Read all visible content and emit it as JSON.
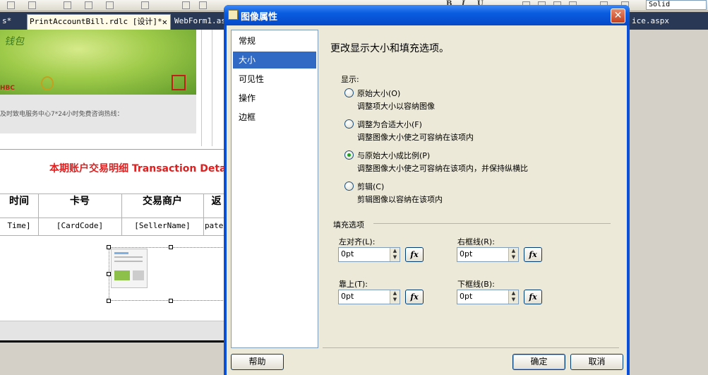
{
  "ide": {
    "toolbar_combo": "Solid",
    "toolbar_format": [
      "B",
      "I",
      "U"
    ],
    "tabs": [
      {
        "label": "s*",
        "active": false
      },
      {
        "label": "PrintAccountBill.rdlc [设计]*",
        "active": true,
        "close": "✕"
      },
      {
        "label": "WebForm1.asp",
        "active": false
      },
      {
        "label": "ice.aspx",
        "active": false
      }
    ]
  },
  "report": {
    "banner_text": "钱包",
    "logo_left": "HBC",
    "hotline": "及时致电服务中心7*24小时免费咨询热线：",
    "section_title": "本期账户交易明细 Transaction Details",
    "headers": [
      "时间",
      "卡号",
      "交易商户",
      "返"
    ],
    "cells": [
      "Time]",
      "[CardCode]",
      "[SellerName]",
      "pateI"
    ]
  },
  "dialog": {
    "title": "图像属性",
    "close_glyph": "✕",
    "nav_items": [
      {
        "label": "常规",
        "selected": false
      },
      {
        "label": "大小",
        "selected": true
      },
      {
        "label": "可见性",
        "selected": false
      },
      {
        "label": "操作",
        "selected": false
      },
      {
        "label": "边框",
        "selected": false
      }
    ],
    "heading": "更改显示大小和填充选项。",
    "display_label": "显示:",
    "display_options": [
      {
        "label": "原始大小(O)",
        "desc": "调整项大小以容纳图像",
        "checked": false
      },
      {
        "label": "调整为合适大小(F)",
        "desc": "调整图像大小使之可容纳在该项内",
        "checked": false
      },
      {
        "label": "与原始大小成比例(P)",
        "desc": "调整图像大小使之可容纳在该项内，并保持纵横比",
        "checked": true
      },
      {
        "label": "剪辑(C)",
        "desc": "剪辑图像以容纳在该项内",
        "checked": false
      }
    ],
    "fill_label": "填充选项",
    "padding": {
      "left": {
        "label": "左对齐(L):",
        "value": "0pt"
      },
      "right": {
        "label": "右框线(R):",
        "value": "0pt"
      },
      "top": {
        "label": "靠上(T):",
        "value": "0pt"
      },
      "bottom": {
        "label": "下框线(B):",
        "value": "0pt"
      }
    },
    "fx_label": "fx",
    "spin_up": "▲",
    "spin_down": "▼",
    "help_button": "帮助",
    "ok_button": "确定",
    "cancel_button": "取消"
  }
}
